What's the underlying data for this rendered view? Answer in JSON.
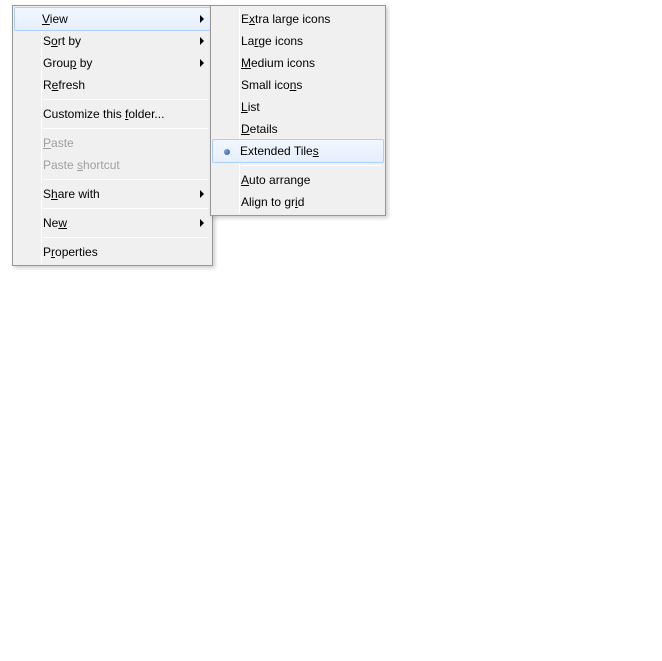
{
  "main_menu": {
    "items": [
      {
        "pre": "",
        "hot": "V",
        "post": "iew",
        "submenu": true,
        "highlighted": true
      },
      {
        "pre": "S",
        "hot": "o",
        "post": "rt by",
        "submenu": true
      },
      {
        "pre": "Grou",
        "hot": "p",
        "post": " by",
        "submenu": true
      },
      {
        "pre": "R",
        "hot": "e",
        "post": "fresh"
      },
      {
        "separator": true
      },
      {
        "pre": "Customize this ",
        "hot": "f",
        "post": "older..."
      },
      {
        "separator": true
      },
      {
        "pre": "",
        "hot": "P",
        "post": "aste",
        "disabled": true
      },
      {
        "pre": "Paste ",
        "hot": "s",
        "post": "hortcut",
        "disabled": true
      },
      {
        "separator": true
      },
      {
        "pre": "S",
        "hot": "h",
        "post": "are with",
        "submenu": true
      },
      {
        "separator": true
      },
      {
        "pre": "Ne",
        "hot": "w",
        "post": "",
        "submenu": true
      },
      {
        "separator": true
      },
      {
        "pre": "P",
        "hot": "r",
        "post": "operties"
      }
    ]
  },
  "sub_menu": {
    "items": [
      {
        "pre": "E",
        "hot": "x",
        "post": "tra large icons"
      },
      {
        "pre": "La",
        "hot": "r",
        "post": "ge icons"
      },
      {
        "pre": "",
        "hot": "M",
        "post": "edium icons"
      },
      {
        "pre": "Small ico",
        "hot": "n",
        "post": "s"
      },
      {
        "pre": "",
        "hot": "L",
        "post": "ist"
      },
      {
        "pre": "",
        "hot": "D",
        "post": "etails"
      },
      {
        "pre": "Extended Tile",
        "hot": "s",
        "post": "",
        "highlighted": true,
        "radio": true
      },
      {
        "separator": true
      },
      {
        "pre": "",
        "hot": "A",
        "post": "uto arrange"
      },
      {
        "pre": "Align to gr",
        "hot": "i",
        "post": "d"
      }
    ]
  }
}
